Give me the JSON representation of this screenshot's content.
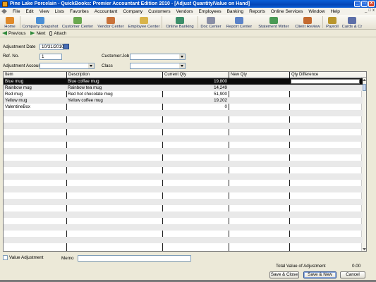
{
  "window": {
    "title": "Pine Lake Porcelain  - QuickBooks: Premier Accountant Edition 2010 - [Adjust Quantity/Value on Hand]",
    "controls": [
      "_",
      "□",
      "X"
    ]
  },
  "menu": {
    "items": [
      "File",
      "Edit",
      "View",
      "Lists",
      "Favorites",
      "Accountant",
      "Company",
      "Customers",
      "Vendors",
      "Employees",
      "Banking",
      "Reports",
      "Online Services",
      "Window",
      "Help"
    ],
    "right_controls": [
      "_",
      "□",
      "x"
    ]
  },
  "toolbar": {
    "buttons": [
      {
        "label": "Home",
        "color": "#e08a2a"
      },
      {
        "label": "Company Snapshot",
        "color": "#4a8fd6"
      },
      {
        "label": "Customer Center",
        "color": "#6aa84f"
      },
      {
        "label": "Vendor Center",
        "color": "#c9733a"
      },
      {
        "label": "Employee Center",
        "color": "#d9b44a"
      },
      {
        "label": "Online Banking",
        "color": "#3d8f6a"
      },
      {
        "label": "Doc Center",
        "color": "#8a8fa6"
      },
      {
        "label": "Report Center",
        "color": "#5b83c9"
      },
      {
        "label": "Statement Writer",
        "color": "#4a9a55"
      },
      {
        "label": "Client Review",
        "color": "#c46a2f"
      },
      {
        "label": "Payroll",
        "color": "#b9962c"
      },
      {
        "label": "Cards & Cr",
        "color": "#5d6fa8"
      }
    ]
  },
  "subtoolbar": {
    "previous": "Previous",
    "next": "Next",
    "attach": "Attach"
  },
  "form": {
    "adjustment_date_label": "Adjustment Date",
    "adjustment_date_value": "10/31/2010",
    "ref_no_label": "Ref. No.",
    "ref_no_value": "1",
    "customer_job_label": "Customer:Job",
    "customer_job_value": "",
    "adjustment_account_label": "Adjustment Account",
    "adjustment_account_value": "",
    "class_label": "Class",
    "class_value": ""
  },
  "table": {
    "columns": [
      "Item",
      "Description",
      "Current Qty",
      "New Qty",
      "Qty Difference"
    ],
    "rows": [
      {
        "item": "Blue mug",
        "description": "Blue coffee mug",
        "current_qty": "19,800",
        "selected": true
      },
      {
        "item": "Rainbow mug",
        "description": "Rainbow tea mug",
        "current_qty": "14,249"
      },
      {
        "item": "Red mug",
        "description": "Red hot chocolate mug",
        "current_qty": "51,900"
      },
      {
        "item": "Yellow mug",
        "description": "Yellow coffee mug",
        "current_qty": "19,202"
      },
      {
        "item": "ValentineBox",
        "description": "",
        "current_qty": "0"
      }
    ]
  },
  "footer": {
    "value_adjustment_label": "Value Adjustment",
    "memo_label": "Memo",
    "memo_value": "",
    "total_label": "Total Value of Adjustment",
    "total_value": "0.00",
    "save_close": "Save & Close",
    "save_new": "Save & New",
    "cancel": "Cancel"
  }
}
